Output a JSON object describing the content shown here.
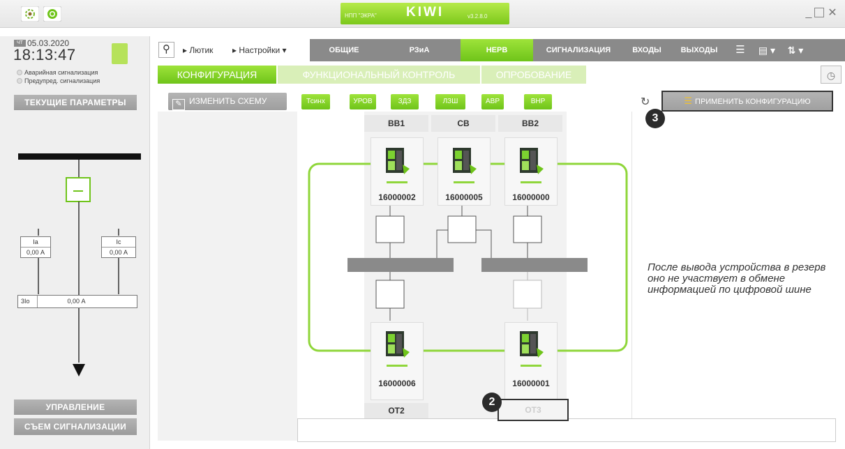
{
  "app": {
    "org": "НПП \"ЭКРА\"",
    "name": "KIWI",
    "version": "v3.2.8.0"
  },
  "window_controls": [
    "minimize",
    "maximize",
    "close"
  ],
  "status": {
    "day": "ЧТ",
    "date": "05.03.2020",
    "time": "18:13:47",
    "alarms": [
      "Аварийная сигнализация",
      "Предупред. сигнализация"
    ]
  },
  "left": {
    "current_params_button": "ТЕКУЩИЕ ПАРАМЕТРЫ",
    "measures": [
      {
        "label": "Ia",
        "value": "0,00 А"
      },
      {
        "label": "Ic",
        "value": "0,00 А"
      }
    ],
    "residual": {
      "label": "3Io",
      "value": "0,00 А"
    },
    "control_button": "УПРАВЛЕНИЕ",
    "reset_button": "СЪЕМ СИГНАЛИЗАЦИИ"
  },
  "breadcrumb": [
    "Лютик",
    "Настройки"
  ],
  "tabs": [
    {
      "label": "ОБЩИЕ",
      "active": false
    },
    {
      "label": "РЗиА",
      "active": false
    },
    {
      "label": "НЕРВ",
      "active": true
    },
    {
      "label": "СИГНАЛИЗАЦИЯ",
      "active": false
    },
    {
      "label": "ВХОДЫ",
      "active": false
    },
    {
      "label": "ВЫХОДЫ",
      "active": false
    }
  ],
  "subtabs": [
    {
      "label": "КОНФИГУРАЦИЯ",
      "active": true
    },
    {
      "label": "ФУНКЦИОНАЛЬНЫЙ КОНТРОЛЬ",
      "active": false
    },
    {
      "label": "ОПРОБОВАНИЕ",
      "active": false
    }
  ],
  "toolbar": {
    "edit_scheme": "ИЗМЕНИТЬ СХЕМУ",
    "functions": [
      "Тсинх",
      "УРОВ",
      "ЗДЗ",
      "ЛЗШ",
      "АВР",
      "ВНР"
    ],
    "apply": "ПРИМЕНИТЬ КОНФИГУРАЦИЮ"
  },
  "scheme": {
    "columns": [
      "ВВ1",
      "СВ",
      "ВВ2"
    ],
    "top_devices": [
      "16000002",
      "16000005",
      "16000000"
    ],
    "bottom_devices": [
      "16000006",
      "16000001"
    ],
    "bottom_labels": [
      "ОТ2",
      "ОТ3"
    ]
  },
  "callouts": [
    "2",
    "3"
  ],
  "note": "После вывода устройства в резерв оно не участвует в обмене информацией по цифровой шине",
  "colors": {
    "accent": "#7cc81b",
    "tab_bar": "#8a8a8a",
    "link_line": "#8fd63a"
  }
}
